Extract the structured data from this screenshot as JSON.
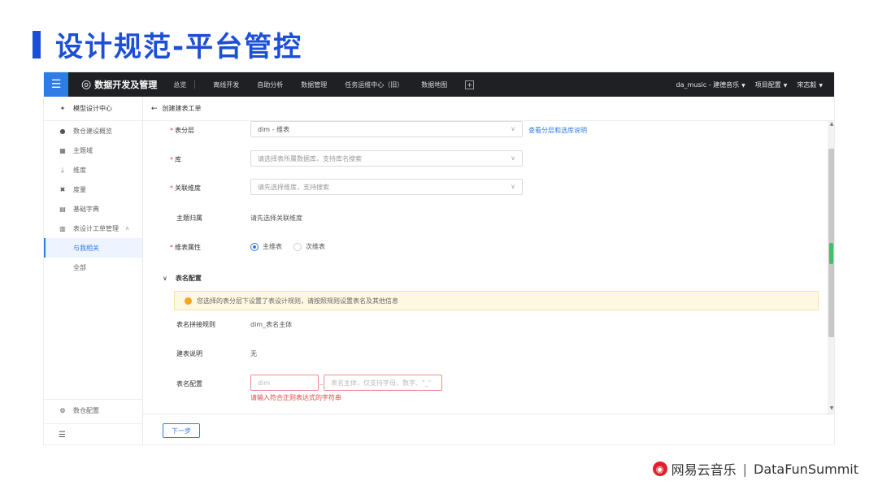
{
  "slide": {
    "title": "设计规范-平台管控",
    "footer_brand": "网易云音乐",
    "footer_sep": "|",
    "footer_event": "DataFunSummit"
  },
  "topnav": {
    "app_name": "数据开发及管理",
    "items": [
      "总览",
      "离线开发",
      "自助分析",
      "数据管理",
      "任务运维中心（旧）",
      "数据地图"
    ],
    "plus": "+",
    "project": "da_music - 建德音乐",
    "project_config": "项目配置",
    "user": "宋志毅"
  },
  "sidebar": {
    "header": "模型设计中心",
    "items": [
      {
        "label": "数仓建设概览",
        "icon": "dashboard-icon"
      },
      {
        "label": "主题域",
        "icon": "grid-icon"
      },
      {
        "label": "维度",
        "icon": "tree-icon"
      },
      {
        "label": "度量",
        "icon": "measure-icon"
      },
      {
        "label": "基础字典",
        "icon": "dict-icon"
      },
      {
        "label": "表设计工单管理",
        "icon": "table-icon"
      }
    ],
    "sub_items": [
      "与我相关",
      "全部"
    ],
    "bottom": "数仓配置",
    "collapse_glyph": "☰"
  },
  "content": {
    "page_title": "创建建表工单",
    "back_glyph": "←",
    "fields": {
      "layer": {
        "label": "表分层",
        "value": "dim - 维表",
        "link": "查看分层和选库说明"
      },
      "db": {
        "label": "库",
        "placeholder": "请选择表所属数据库，支持库名搜索"
      },
      "dimension": {
        "label": "关联维度",
        "placeholder": "请先选择维度，支持搜索"
      },
      "theme": {
        "label": "主题归属",
        "value": "请先选择关联维度"
      },
      "attr": {
        "label": "维表属性",
        "options": [
          "主维表",
          "次维表"
        ],
        "selected": 0
      }
    },
    "section": {
      "title": "表名配置",
      "notice": "您选择的表分层下设置了表设计规则，请按照规则设置表名及其他信息",
      "rule_label": "表名拼接规则",
      "rule_value": "dim_表名主体",
      "desc_label": "建表说明",
      "desc_value": "无",
      "name_label": "表名配置",
      "prefix_placeholder": "dim",
      "body_placeholder": "表名主体，仅支持字母、数字、\"_\"",
      "dash": "_",
      "error": "请输入符合正则表达式的字符串"
    },
    "next_button": "下一步"
  },
  "colors": {
    "brand_blue": "#1c4fd8",
    "accent": "#2f7be8",
    "nav_bg": "#1f2023",
    "required": "#e34545",
    "notice_bg": "#fff8e1",
    "footer_logo_red": "#e0202b"
  }
}
